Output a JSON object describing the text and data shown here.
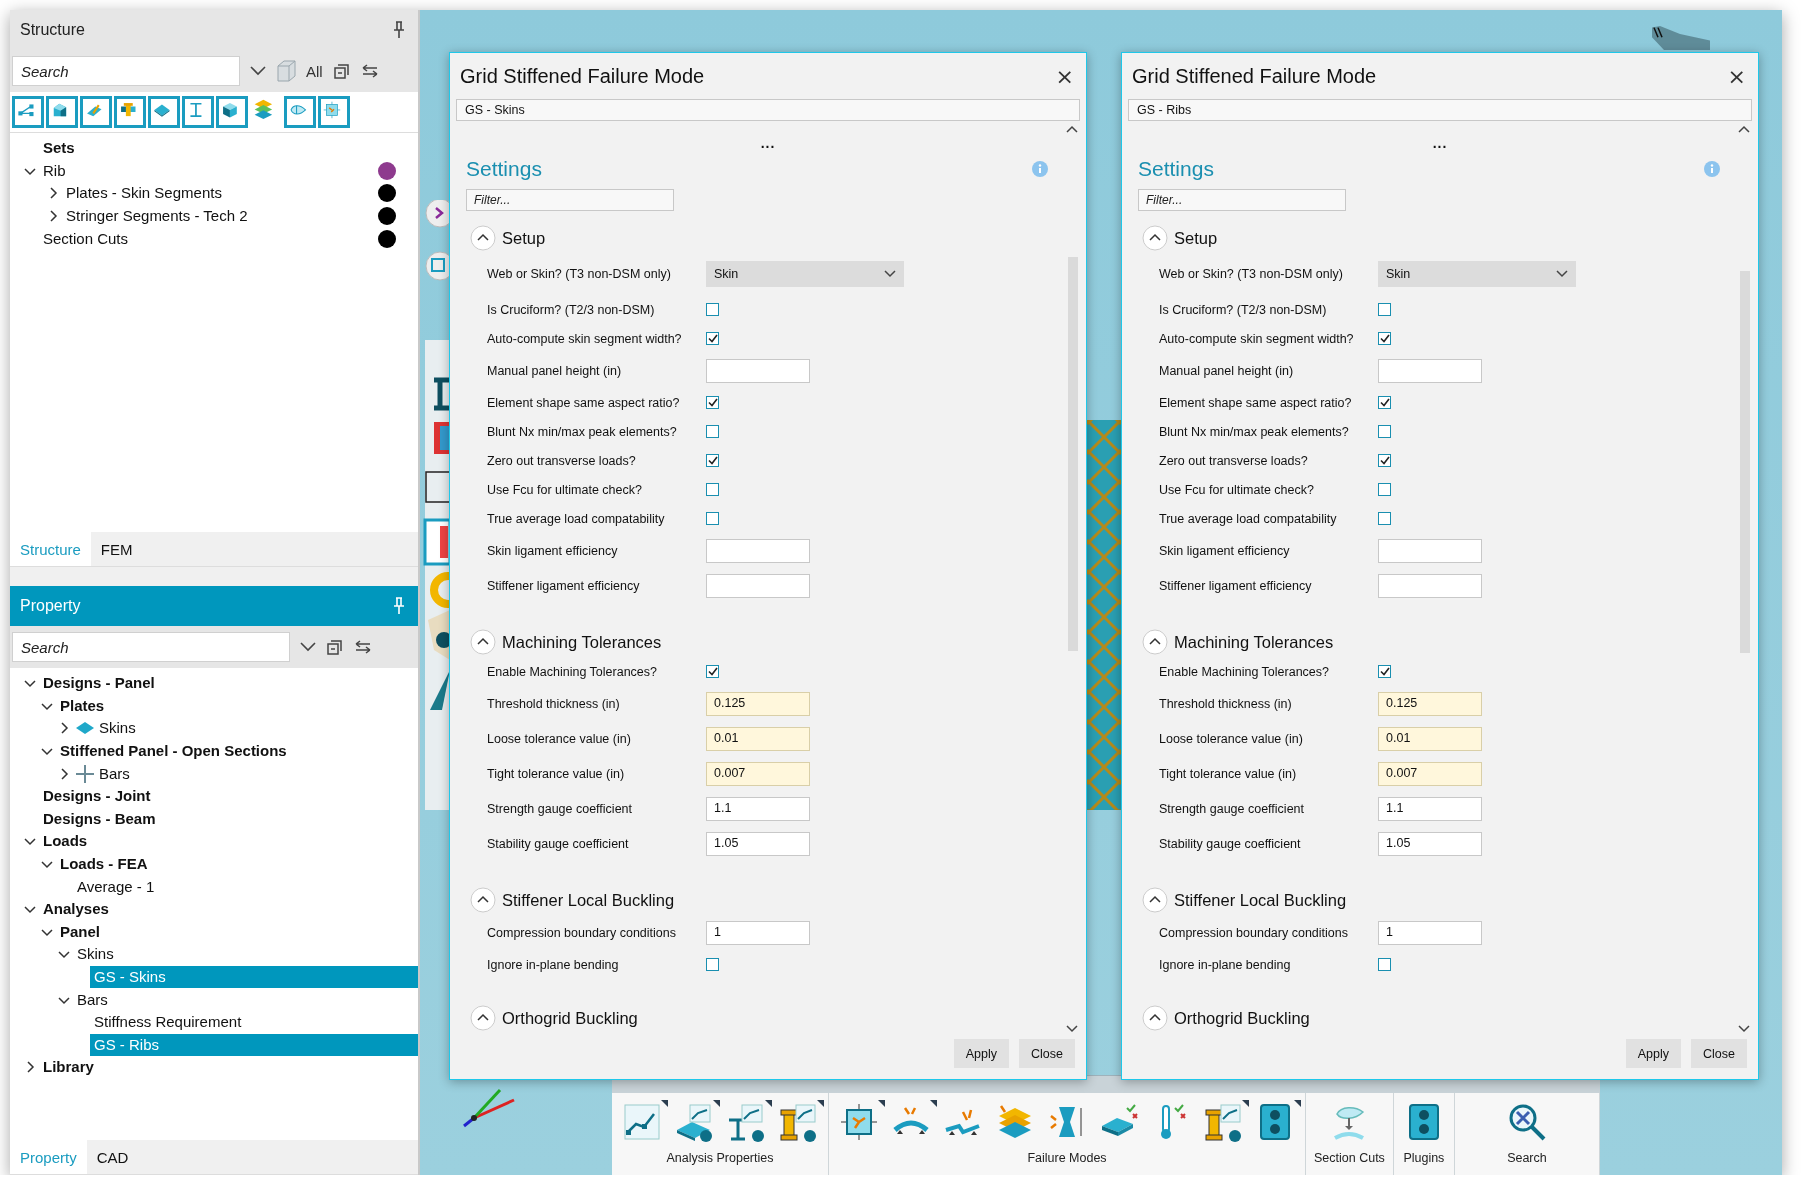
{
  "structure_panel": {
    "title": "Structure",
    "active": false,
    "search": {
      "placeholder": "Search"
    },
    "filter_label": "All",
    "toolbar": [
      {
        "kind": "nodes",
        "on": true
      },
      {
        "kind": "wedge",
        "on": true
      },
      {
        "kind": "angle",
        "on": true
      },
      {
        "kind": "column",
        "on": true
      },
      {
        "kind": "plate",
        "on": true
      },
      {
        "kind": "beam",
        "on": true
      },
      {
        "kind": "cube",
        "on": true
      },
      {
        "kind": "layers",
        "on": false
      },
      {
        "kind": "lens",
        "on": true
      },
      {
        "kind": "chip",
        "on": true
      }
    ],
    "tree": [
      {
        "label": "Sets",
        "bold": true,
        "selected": false
      },
      {
        "label": "Rib",
        "bold": false,
        "selected": false,
        "expanded": true,
        "color": "#8e3a8e",
        "children": [
          {
            "label": "Plates - Skin Segments",
            "bold": false,
            "selected": false,
            "expanded": false,
            "color": "#000000"
          },
          {
            "label": "Stringer Segments - Tech 2",
            "bold": false,
            "selected": false,
            "expanded": false,
            "color": "#000000"
          }
        ]
      },
      {
        "label": "Section Cuts",
        "bold": false,
        "selected": false,
        "color": "#000000"
      }
    ],
    "tabs": [
      {
        "label": "Structure",
        "selected": true
      },
      {
        "label": "FEM",
        "selected": false
      }
    ]
  },
  "property_panel": {
    "title": "Property",
    "active": true,
    "search": {
      "placeholder": "Search"
    },
    "tree": [
      {
        "label": "Designs - Panel",
        "bold": true,
        "selected": false,
        "expanded": true,
        "children": [
          {
            "label": "Plates",
            "bold": true,
            "selected": false,
            "expanded": true,
            "children": [
              {
                "label": "Skins",
                "kind": "plate",
                "bold": false,
                "selected": false,
                "expanded": false
              }
            ]
          },
          {
            "label": "Stiffened Panel - Open Sections",
            "bold": true,
            "selected": false,
            "expanded": true,
            "children": [
              {
                "label": "Bars",
                "kind": "bar",
                "bold": false,
                "selected": false,
                "expanded": false
              }
            ]
          }
        ]
      },
      {
        "label": "Designs - Joint",
        "bold": true,
        "selected": false
      },
      {
        "label": "Designs - Beam",
        "bold": true,
        "selected": false
      },
      {
        "label": "Loads",
        "bold": true,
        "selected": false,
        "expanded": true,
        "children": [
          {
            "label": "Loads - FEA",
            "bold": true,
            "selected": false,
            "expanded": true,
            "children": [
              {
                "label": "Average - 1",
                "bold": false,
                "selected": false
              }
            ]
          }
        ]
      },
      {
        "label": "Analyses",
        "bold": true,
        "selected": false,
        "expanded": true,
        "children": [
          {
            "label": "Panel",
            "bold": true,
            "selected": false,
            "expanded": true,
            "children": [
              {
                "label": "Skins",
                "bold": false,
                "selected": false,
                "expanded": true,
                "children": [
                  {
                    "label": "GS - Skins",
                    "bold": false,
                    "selected": true
                  }
                ]
              },
              {
                "label": "Bars",
                "bold": false,
                "selected": false,
                "expanded": true,
                "children": [
                  {
                    "label": "Stiffness Requirement",
                    "bold": false,
                    "selected": false
                  },
                  {
                    "label": "GS - Ribs",
                    "bold": false,
                    "selected": true
                  }
                ]
              }
            ]
          }
        ]
      },
      {
        "label": "Library",
        "bold": true,
        "selected": false,
        "expanded": false
      }
    ],
    "tabs": [
      {
        "label": "Property",
        "selected": true
      },
      {
        "label": "CAD",
        "selected": false
      }
    ]
  },
  "dialogs": [
    {
      "title": "Grid Stiffened Failure Mode",
      "close": "×",
      "subject": "GS - Skins",
      "more": "...",
      "heading": "Settings",
      "filter": {
        "placeholder": "Filter..."
      },
      "sections": [
        {
          "title": "Setup",
          "expanded": true,
          "rows": [
            {
              "label": "Web or Skin? (T3 non-DSM only)",
              "kind": "select",
              "value": "Skin"
            },
            {
              "label": "Is Cruciform? (T2/3 non-DSM)",
              "kind": "checkbox",
              "checked": false
            },
            {
              "label": "Auto-compute skin segment width?",
              "kind": "checkbox",
              "checked": true
            },
            {
              "label": "Manual panel height (in)",
              "kind": "input",
              "highlighted": false
            },
            {
              "label": "Element shape same aspect ratio?",
              "kind": "checkbox",
              "checked": true
            },
            {
              "label": "Blunt Nx min/max peak elements?",
              "kind": "checkbox",
              "checked": false
            },
            {
              "label": "Zero out transverse loads?",
              "kind": "checkbox",
              "checked": true
            },
            {
              "label": "Use Fcu for ultimate check?",
              "kind": "checkbox",
              "checked": false
            },
            {
              "label": "True average load compatability",
              "kind": "checkbox",
              "checked": false
            },
            {
              "label": "Skin ligament efficiency",
              "kind": "input",
              "highlighted": false
            },
            {
              "label": "Stiffener ligament efficiency",
              "kind": "input",
              "highlighted": false
            }
          ]
        },
        {
          "title": "Machining Tolerances",
          "expanded": true,
          "rows": [
            {
              "label": "Enable Machining Tolerances?",
              "kind": "checkbox",
              "checked": true
            },
            {
              "label": "Threshold thickness (in)",
              "kind": "input",
              "value": "0.125",
              "highlighted": true
            },
            {
              "label": "Loose tolerance value (in)",
              "kind": "input",
              "value": "0.01",
              "highlighted": true
            },
            {
              "label": "Tight tolerance value (in)",
              "kind": "input",
              "value": "0.007",
              "highlighted": true
            },
            {
              "label": "Strength gauge coefficient",
              "kind": "input",
              "value": "1.1",
              "highlighted": false
            },
            {
              "label": "Stability gauge coefficient",
              "kind": "input",
              "value": "1.05",
              "highlighted": false
            }
          ]
        },
        {
          "title": "Stiffener Local Buckling",
          "expanded": true,
          "rows": [
            {
              "label": "Compression boundary conditions",
              "kind": "input",
              "value": "1",
              "highlighted": false
            },
            {
              "label": "Ignore in-plane bending",
              "kind": "checkbox",
              "checked": false
            }
          ]
        },
        {
          "title": "Orthogrid Buckling",
          "expanded": true
        }
      ],
      "buttons": [
        "Apply",
        "Close"
      ]
    },
    {
      "title": "Grid Stiffened Failure Mode",
      "close": "×",
      "subject": "GS - Ribs",
      "more": "...",
      "heading": "Settings",
      "filter": {
        "placeholder": "Filter..."
      },
      "sections": [
        {
          "title": "Setup",
          "expanded": true,
          "rows": [
            {
              "label": "Web or Skin? (T3 non-DSM only)",
              "kind": "select",
              "value": "Skin"
            },
            {
              "label": "Is Cruciform? (T2/3 non-DSM)",
              "kind": "checkbox",
              "checked": false
            },
            {
              "label": "Auto-compute skin segment width?",
              "kind": "checkbox",
              "checked": true
            },
            {
              "label": "Manual panel height (in)",
              "kind": "input",
              "highlighted": false
            },
            {
              "label": "Element shape same aspect ratio?",
              "kind": "checkbox",
              "checked": true
            },
            {
              "label": "Blunt Nx min/max peak elements?",
              "kind": "checkbox",
              "checked": false
            },
            {
              "label": "Zero out transverse loads?",
              "kind": "checkbox",
              "checked": true
            },
            {
              "label": "Use Fcu for ultimate check?",
              "kind": "checkbox",
              "checked": false
            },
            {
              "label": "True average load compatability",
              "kind": "checkbox",
              "checked": false
            },
            {
              "label": "Skin ligament efficiency",
              "kind": "input",
              "highlighted": false
            },
            {
              "label": "Stiffener ligament efficiency",
              "kind": "input",
              "highlighted": false
            }
          ]
        },
        {
          "title": "Machining Tolerances",
          "expanded": true,
          "rows": [
            {
              "label": "Enable Machining Tolerances?",
              "kind": "checkbox",
              "checked": true
            },
            {
              "label": "Threshold thickness (in)",
              "kind": "input",
              "value": "0.125",
              "highlighted": true
            },
            {
              "label": "Loose tolerance value (in)",
              "kind": "input",
              "value": "0.01",
              "highlighted": true
            },
            {
              "label": "Tight tolerance value (in)",
              "kind": "input",
              "value": "0.007",
              "highlighted": true
            },
            {
              "label": "Strength gauge coefficient",
              "kind": "input",
              "value": "1.1",
              "highlighted": false
            },
            {
              "label": "Stability gauge coefficient",
              "kind": "input",
              "value": "1.05",
              "highlighted": false
            }
          ]
        },
        {
          "title": "Stiffener Local Buckling",
          "expanded": true,
          "rows": [
            {
              "label": "Compression boundary conditions",
              "kind": "input",
              "value": "1",
              "highlighted": false
            },
            {
              "label": "Ignore in-plane bending",
              "kind": "checkbox",
              "checked": false
            }
          ]
        },
        {
          "title": "Orthogrid Buckling",
          "expanded": true
        }
      ],
      "buttons": [
        "Apply",
        "Close"
      ]
    }
  ],
  "ribbon": {
    "groups": [
      {
        "label": "Analysis Properties",
        "tools": [
          {
            "kind": "chart",
            "has_menu": true
          },
          {
            "kind": "plate",
            "has_menu": true
          },
          {
            "kind": "beam",
            "has_menu": true
          },
          {
            "kind": "column",
            "has_menu": true
          }
        ]
      },
      {
        "label": "Failure Modes",
        "tools": [
          {
            "kind": "panel",
            "has_menu": true
          },
          {
            "kind": "arch",
            "has_menu": true
          },
          {
            "kind": "kink",
            "has_menu": false
          },
          {
            "kind": "layers",
            "has_menu": false
          },
          {
            "kind": "hourglass",
            "has_menu": false
          },
          {
            "kind": "slab",
            "has_menu": false
          },
          {
            "kind": "thermometer",
            "has_menu": false
          },
          {
            "kind": "column",
            "has_menu": true
          },
          {
            "kind": "outlet",
            "has_menu": true
          }
        ]
      },
      {
        "label": "Section Cuts",
        "tools": [
          {
            "kind": "section",
            "has_menu": false
          }
        ]
      },
      {
        "label": "Plugins",
        "tools": [
          {
            "kind": "outlet",
            "has_menu": false
          }
        ]
      },
      {
        "label": "Search",
        "tools": [
          {
            "kind": "magnifier",
            "has_menu": false
          }
        ]
      }
    ]
  }
}
